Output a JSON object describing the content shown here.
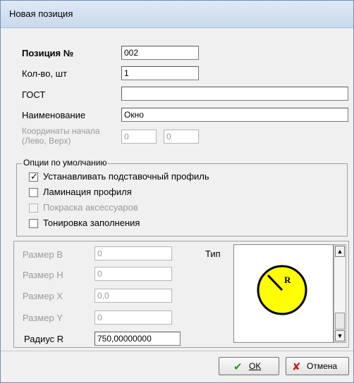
{
  "window": {
    "title": "Новая позиция"
  },
  "fields": {
    "position_label": "Позиция №",
    "position_value": "002",
    "qty_label": "Кол-во, шт",
    "qty_value": "1",
    "gost_label": "ГОСТ",
    "gost_value": "",
    "name_label": "Наименование",
    "name_value": "Окно",
    "coords_label_line1": "Координаты начала",
    "coords_label_line2": "(Лево, Верх)",
    "coord_left": "0",
    "coord_top": "0"
  },
  "defaults_group": {
    "legend": "Опции по умолчанию",
    "options": [
      {
        "label": "Устанавливать подставочный профиль",
        "checked": true,
        "enabled": true
      },
      {
        "label": "Ламинация профиля",
        "checked": false,
        "enabled": true
      },
      {
        "label": "Покраска аксессуаров",
        "checked": false,
        "enabled": false
      },
      {
        "label": "Тонировка заполнения",
        "checked": false,
        "enabled": true
      }
    ]
  },
  "sizes": {
    "size_b_label": "Размер B",
    "size_b_value": "0",
    "size_h_label": "Размер H",
    "size_h_value": "0",
    "size_x_label": "Размер X",
    "size_x_value": "0,0",
    "size_y_label": "Размер Y",
    "size_y_value": "0",
    "radius_label": "Радиус R",
    "radius_value": "750,00000000",
    "type_label": "Тип"
  },
  "preview": {
    "shape_label": "R",
    "fill_color": "#ffff00",
    "stroke_color": "#000000"
  },
  "buttons": {
    "ok_label": "OK",
    "ok_icon": "checkmark-icon",
    "cancel_label": "Отмена",
    "cancel_icon": "cross-icon"
  },
  "colors": {
    "ok_check": "#2a9a2a",
    "cancel_cross": "#c81e1e"
  }
}
